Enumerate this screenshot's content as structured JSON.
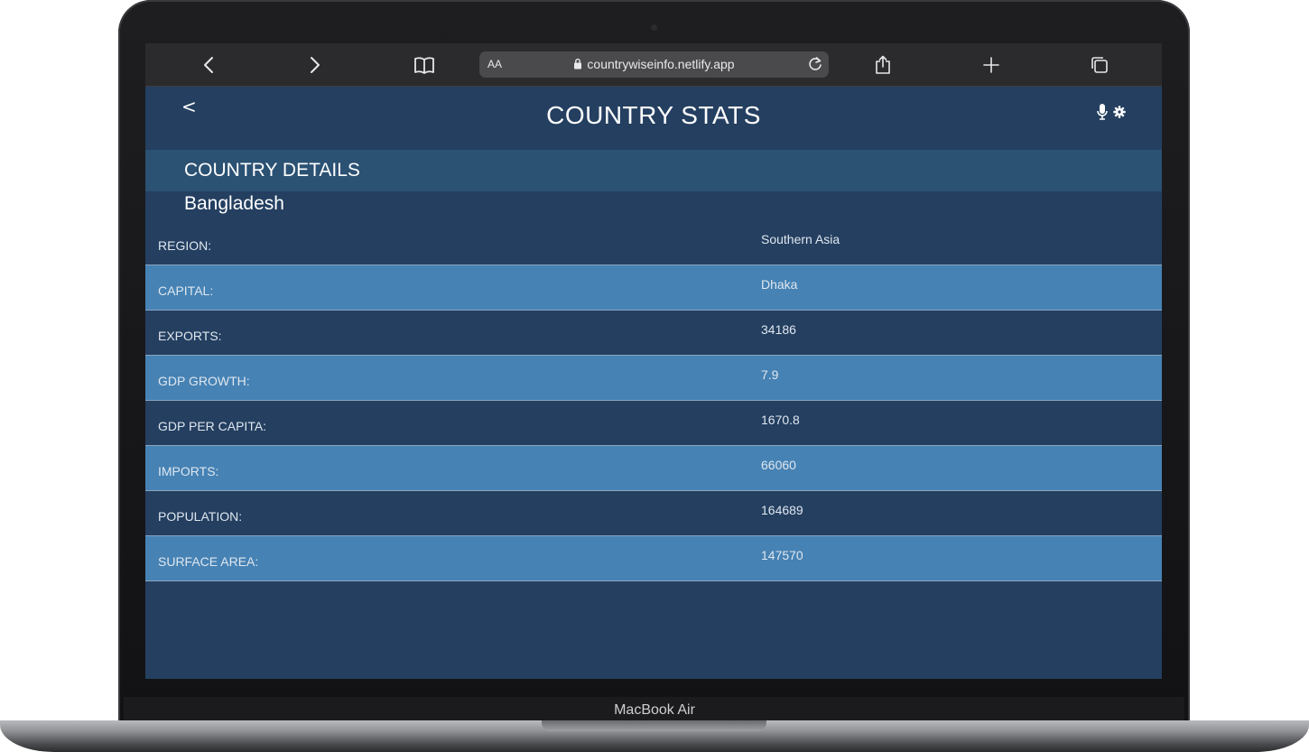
{
  "device": {
    "brand_label": "MacBook Air"
  },
  "browser": {
    "text_size_label": "AA",
    "url": "countrywiseinfo.netlify.app"
  },
  "header": {
    "back_label": "<",
    "title": "COUNTRY STATS"
  },
  "section": {
    "title": "COUNTRY DETAILS",
    "country": "Bangladesh"
  },
  "details": [
    {
      "label": "REGION:",
      "value": "Southern Asia"
    },
    {
      "label": "CAPITAL:",
      "value": "Dhaka"
    },
    {
      "label": "EXPORTS:",
      "value": "34186"
    },
    {
      "label": "GDP GROWTH:",
      "value": "7.9"
    },
    {
      "label": "GDP PER CAPITA:",
      "value": "1670.8"
    },
    {
      "label": "IMPORTS:",
      "value": "66060"
    },
    {
      "label": "POPULATION:",
      "value": "164689"
    },
    {
      "label": "SURFACE AREA:",
      "value": "147570"
    }
  ],
  "colors": {
    "app_background": "#243f60",
    "section_bar": "#2b5173",
    "row_light": "#4682b4",
    "row_dark": "#243f60"
  },
  "icons": [
    "back-chevron-icon",
    "forward-chevron-icon",
    "bookmarks-icon",
    "lock-icon",
    "reload-icon",
    "share-icon",
    "new-tab-icon",
    "tabs-icon",
    "microphone-icon",
    "gear-icon"
  ]
}
